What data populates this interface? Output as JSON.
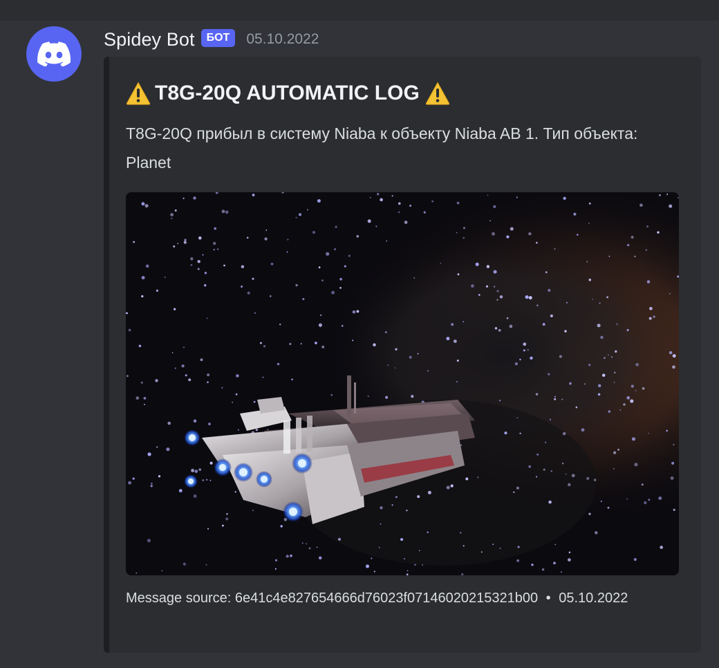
{
  "message": {
    "author": "Spidey Bot",
    "bot_tag": "БОТ",
    "timestamp": "05.10.2022",
    "avatar_icon": "discord-logo-icon"
  },
  "embed": {
    "title": "T8G-20Q AUTOMATIC LOG",
    "title_icon": "warning-icon",
    "description": "T8G-20Q прибыл в систему Niaba к объекту Niaba AB 1. Тип объекта: Planet",
    "image_alt": "spaceship-in-nebula-image",
    "footer_text": "Message source: 6e41c4e827654666d76023f07146020215321b00",
    "footer_separator": "•",
    "footer_date": "05.10.2022"
  },
  "colors": {
    "background": "#313338",
    "embed_background": "#2b2d31",
    "bot_tag": "#5865f2",
    "avatar": "#5865f2",
    "warning": "#f4c232"
  }
}
